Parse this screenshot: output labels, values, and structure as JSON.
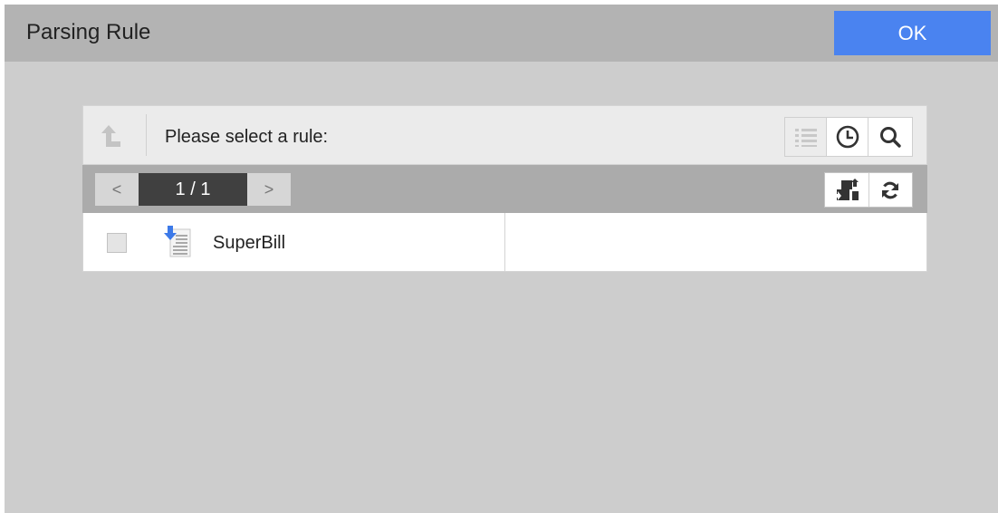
{
  "window": {
    "title": "Parsing Rule",
    "ok_label": "OK"
  },
  "toolbar": {
    "prompt": "Please select a rule:",
    "icons": [
      "up-arrow-icon",
      "list-view-icon",
      "clock-icon",
      "search-icon"
    ]
  },
  "pagination": {
    "prev_label": "<",
    "page": "1 / 1",
    "next_label": ">",
    "action_icons": [
      "transfer-icon",
      "refresh-icon"
    ]
  },
  "rules": [
    {
      "name": "SuperBill",
      "checked": false,
      "icon": "import-document-icon"
    }
  ],
  "colors": {
    "accent": "#4a83f0",
    "window_bg": "#cdcdcd",
    "titlebar_bg": "#b3b3b3",
    "pager_bg": "#ababab",
    "page_indicator_bg": "#404040"
  }
}
